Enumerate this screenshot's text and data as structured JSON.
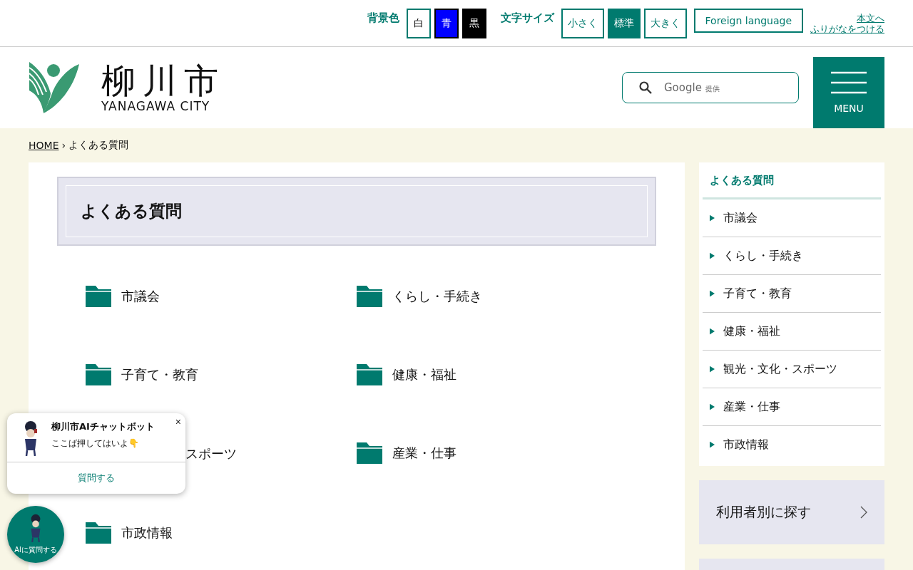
{
  "utility_bar": {
    "bg_label": "背景色",
    "bg_options": [
      {
        "label": "白",
        "color": "#ffffff",
        "selected": true
      },
      {
        "label": "青",
        "color": "#0000ff",
        "selected": false
      },
      {
        "label": "黒",
        "color": "#000000",
        "selected": false
      }
    ],
    "size_label": "文字サイズ",
    "size_options": [
      {
        "label": "小さく",
        "selected": false
      },
      {
        "label": "標準",
        "selected": true
      },
      {
        "label": "大きく",
        "selected": false
      }
    ],
    "foreign": "Foreign language",
    "skip_link": "本文へ",
    "furigana_link": "ふりがなをつける"
  },
  "header": {
    "logo_title": "柳川市",
    "logo_sub": "YANAGAWA CITY",
    "search_brand": "Google",
    "search_suffix": "提供",
    "menu": "MENU"
  },
  "breadcrumb_separator": "›",
  "breadcrumb": [
    {
      "label": "HOME",
      "link": true
    },
    {
      "label": "よくある質問",
      "link": false
    }
  ],
  "page_title": "よくある質問",
  "categories": [
    {
      "kind": "folder",
      "label": "市議会"
    },
    {
      "kind": "folder",
      "label": "くらし・手続き"
    },
    {
      "kind": "folder",
      "label": "子育て・教育"
    },
    {
      "kind": "folder",
      "label": "健康・福祉"
    },
    {
      "kind": "covered",
      "label": "スポーツ"
    },
    {
      "kind": "folder",
      "label": "産業・仕事"
    },
    {
      "kind": "folder",
      "label": "市政情報"
    }
  ],
  "sidebar": {
    "title": "よくある質問",
    "items": [
      "市議会",
      "くらし・手続き",
      "子育て・教育",
      "健康・福祉",
      "観光・文化・スポーツ",
      "産業・仕事",
      "市政情報"
    ],
    "panels": [
      {
        "label": "利用者別に探す"
      }
    ]
  },
  "chatbot": {
    "title": "柳川市AIチャットボット",
    "message": "ここば押してはいよ👇",
    "close": "×",
    "action": "質問する",
    "fab_label": "AIに質問する"
  }
}
